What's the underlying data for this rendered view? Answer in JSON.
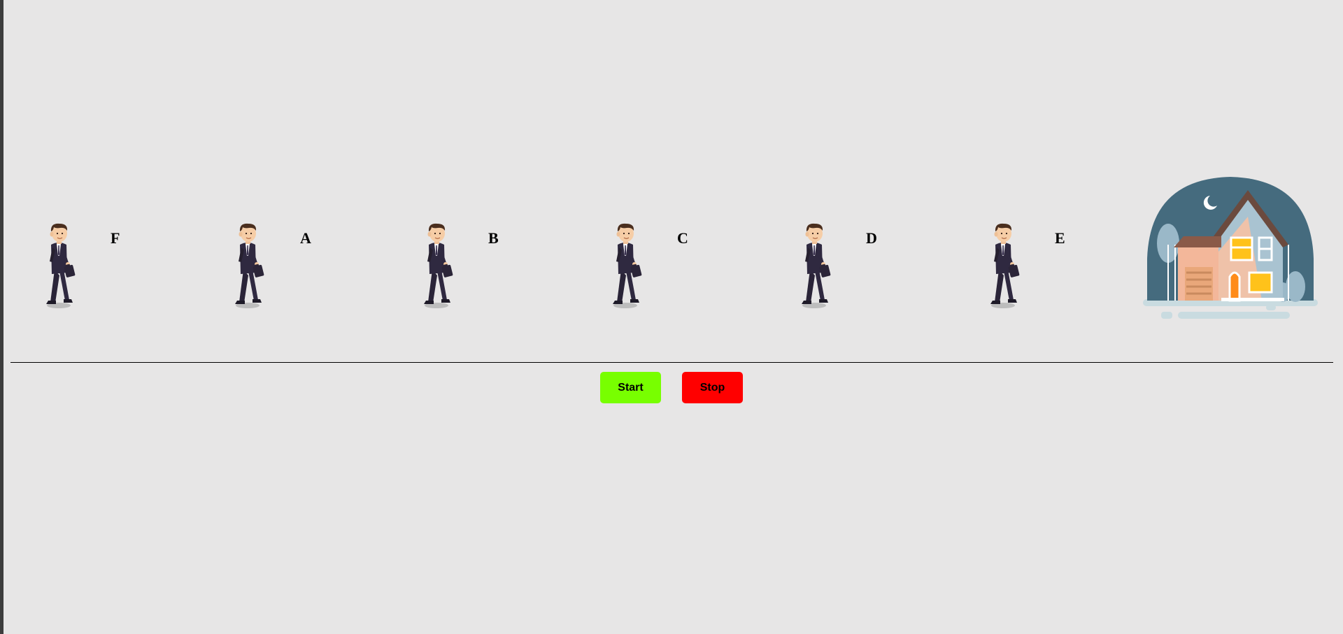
{
  "walkers": [
    {
      "label": "F"
    },
    {
      "label": "A"
    },
    {
      "label": "B"
    },
    {
      "label": "C"
    },
    {
      "label": "D"
    },
    {
      "label": "E"
    }
  ],
  "controls": {
    "start_label": "Start",
    "stop_label": "Stop",
    "start_color": "#78ff00",
    "stop_color": "#ff0000"
  },
  "colors": {
    "background": "#e7e6e6",
    "house_dome": "#456b7e",
    "window_glow": "#ffc21a"
  },
  "icons": {
    "walker": "businessman-walking-icon",
    "destination": "house-night-icon"
  }
}
